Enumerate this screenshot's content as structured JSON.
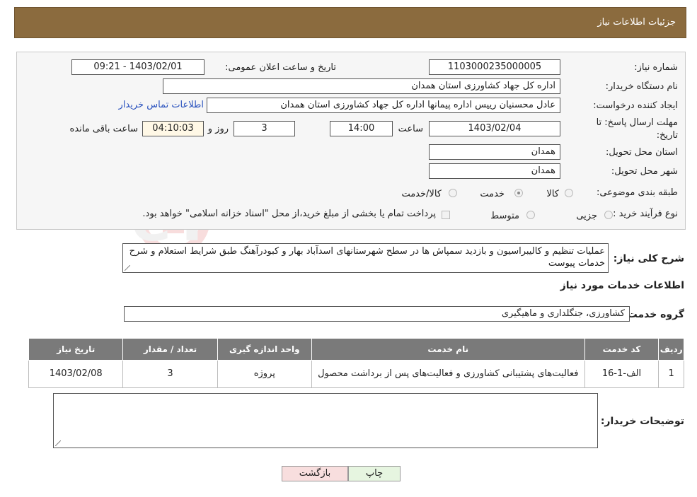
{
  "header": {
    "title": "جزئیات اطلاعات نیاز"
  },
  "form": {
    "need_number_label": "شماره نیاز:",
    "need_number": "1103000235000005",
    "announce_label": "تاریخ و ساعت اعلان عمومی:",
    "announce_value": "1403/02/01 - 09:21",
    "buyer_org_label": "نام دستگاه خریدار:",
    "buyer_org": "اداره کل جهاد کشاورزی استان همدان",
    "creator_label": "ایجاد کننده درخواست:",
    "creator": "عادل محسنیان رییس اداره پیمانها  اداره کل جهاد کشاورزی استان همدان",
    "contact_link": "اطلاعات تماس خریدار",
    "deadline_label_1": "مهلت ارسال پاسخ: تا",
    "deadline_label_2": "تاریخ:",
    "deadline_date": "1403/02/04",
    "time_label": "ساعت",
    "deadline_time": "14:00",
    "days_value": "3",
    "days_label": "روز و",
    "remaining_time": "04:10:03",
    "remaining_label": "ساعت باقی مانده",
    "province_label": "استان محل تحویل:",
    "province": "همدان",
    "city_label": "شهر محل تحویل:",
    "city": "همدان",
    "category_label": "طبقه بندی موضوعی:",
    "category_options": [
      "کالا",
      "خدمت",
      "کالا/خدمت"
    ],
    "category_selected": "خدمت",
    "process_label": "نوع فرآیند خرید :",
    "process_options": [
      "جزیی",
      "متوسط"
    ],
    "payment_note": "پرداخت تمام یا بخشی از مبلغ خرید،از محل \"اسناد خزانه اسلامی\" خواهد بود."
  },
  "description": {
    "label": "شرح کلی نیاز:",
    "text": "عملیات تنظیم و  کالیبراسیون و بازدید سمپاش ها  در سطح شهرستانهای اسدآباد بهار و کبودرآهنگ طبق شرایط استعلام و شرح خدمات پیوست"
  },
  "services": {
    "section_title": "اطلاعات خدمات مورد نیاز",
    "group_label": "گروه خدمت:",
    "group_value": "کشاورزی، جنگلداری و ماهیگیری",
    "columns": [
      "ردیف",
      "کد خدمت",
      "نام خدمت",
      "واحد اندازه گیری",
      "تعداد / مقدار",
      "تاریخ نیاز"
    ],
    "rows": [
      [
        "1",
        "الف-1-16",
        "فعالیت‌های پشتیبانی کشاورزی و فعالیت‌های پس از برداشت محصول",
        "پروژه",
        "3",
        "1403/02/08"
      ]
    ]
  },
  "buyer_notes": {
    "label": "توضیحات خریدار:",
    "text": ""
  },
  "buttons": {
    "print": "چاپ",
    "back": "بازگشت"
  },
  "watermark_text": "AriaTender.neT",
  "colors": {
    "header": "#8b6b3e",
    "table_header": "#7a7a7a",
    "link": "#2a52be",
    "print_btn": "#e6f5e0",
    "back_btn": "#f8dede"
  }
}
